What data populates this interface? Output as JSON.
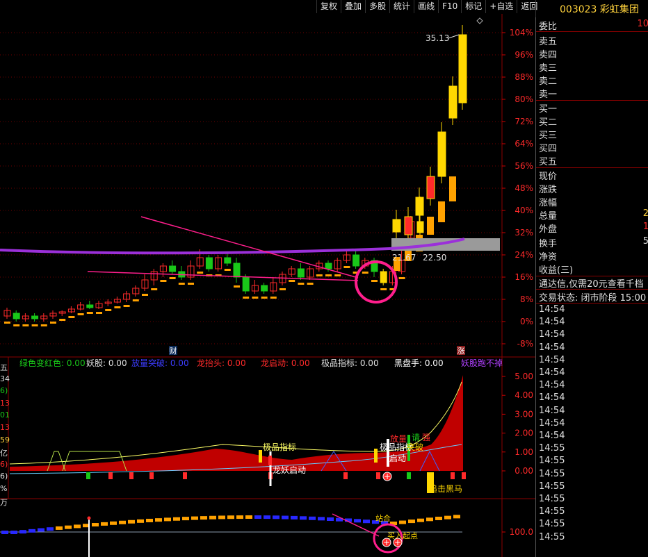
{
  "toolbar": [
    "复权",
    "叠加",
    "多股",
    "统计",
    "画线",
    "F10",
    "标记",
    "+自选",
    "返回"
  ],
  "stock_title": "003023 彩虹集团",
  "side": {
    "weibi_label": "委比",
    "weibi_value": "10",
    "sell": [
      "卖五",
      "卖四",
      "卖三",
      "卖二",
      "卖一"
    ],
    "buy": [
      "买一",
      "买二",
      "买三",
      "买四",
      "买五"
    ],
    "stats": [
      {
        "label": "现价",
        "value": ""
      },
      {
        "label": "涨跌",
        "value": ""
      },
      {
        "label": "涨幅",
        "value": ""
      },
      {
        "label": "总量",
        "value": "2"
      },
      {
        "label": "外盘",
        "value": "1"
      },
      {
        "label": "换手",
        "value": "5"
      },
      {
        "label": "净资",
        "value": ""
      },
      {
        "label": "收益(三)",
        "value": ""
      }
    ],
    "notice": "通达信,仅需20元查看千档",
    "trade_status": "交易状态: 闭市阶段 15:00",
    "ticks": [
      "14:54",
      "14:54",
      "14:54",
      "14:54",
      "14:54",
      "14:54",
      "14:54",
      "14:54",
      "14:54",
      "14:54",
      "14:54",
      "14:55",
      "14:55",
      "14:55",
      "14:55",
      "14:55",
      "14:55",
      "14:55",
      "14:55"
    ]
  },
  "price_axis": [
    "104%",
    "96%",
    "88%",
    "80%",
    "72%",
    "64%",
    "56%",
    "48%",
    "40%",
    "32%",
    "24%",
    "16%",
    "8%",
    "0%",
    "-8%"
  ],
  "price_labels": {
    "high": "35.13",
    "a": "21.67",
    "b": "22.50"
  },
  "markers": {
    "cai": "财",
    "zhang": "涨"
  },
  "indicator_header": [
    {
      "label": "绿色变红色: ",
      "value": "0.00",
      "color": "#19c819"
    },
    {
      "label": "妖股: ",
      "value": "0.00",
      "color": "#e0e0e0"
    },
    {
      "label": "放量突破: ",
      "value": "0.00",
      "color": "#3c3cff"
    },
    {
      "label": "龙抬头: ",
      "value": "0.00",
      "color": "#ff2a2a"
    },
    {
      "label": "龙启动: ",
      "value": "0.00",
      "color": "#ff2a2a"
    },
    {
      "label": "极品指标: ",
      "value": "0.00",
      "color": "#e0e0e0"
    },
    {
      "label": "黑盘手: ",
      "value": "0.00",
      "color": "#ffffff"
    },
    {
      "label": "妖股跑不掉",
      "value": "",
      "color": "#b040ff"
    }
  ],
  "ind_axis": [
    "5.00",
    "4.00",
    "3.00",
    "2.00",
    "1.00",
    "0.00"
  ],
  "ind_texts": {
    "jipin": "极品指标",
    "longyao": "龙妖启动",
    "fangliang": "放量",
    "tuopo": "突破",
    "jipin2": "极品指标",
    "qidong": "启动",
    "tou": "请",
    "qiang": "强",
    "heima": "追击黑马"
  },
  "left_cut": [
    {
      "text": "五",
      "color": "#e0e0e0"
    },
    {
      "text": "34",
      "color": "#e0e0e0"
    },
    {
      "text": "6)",
      "color": "#19c819"
    },
    {
      "text": "13",
      "color": "#ff2a2a"
    },
    {
      "text": "01",
      "color": "#19c819"
    },
    {
      "text": "13",
      "color": "#ff2a2a"
    },
    {
      "text": "59",
      "color": "#ffd23c"
    },
    {
      "text": "亿",
      "color": "#e0e0e0"
    },
    {
      "text": "6)",
      "color": "#ff2a2a"
    },
    {
      "text": "6)",
      "color": "#e0e0e0"
    },
    {
      "text": "%",
      "color": "#e0e0e0"
    },
    {
      "text": "万",
      "color": "#e0e0e0"
    }
  ],
  "bottom": {
    "axis": "100.0",
    "zhan": "站合",
    "mai": "买入起点"
  },
  "colors": {
    "up": "#ff2a2a",
    "down": "#19c819",
    "gold": "#ffd700",
    "orange": "#ffa200",
    "purple": "#9b30d9",
    "magenta": "#ff1e8c",
    "grid": "#8b0000"
  }
}
